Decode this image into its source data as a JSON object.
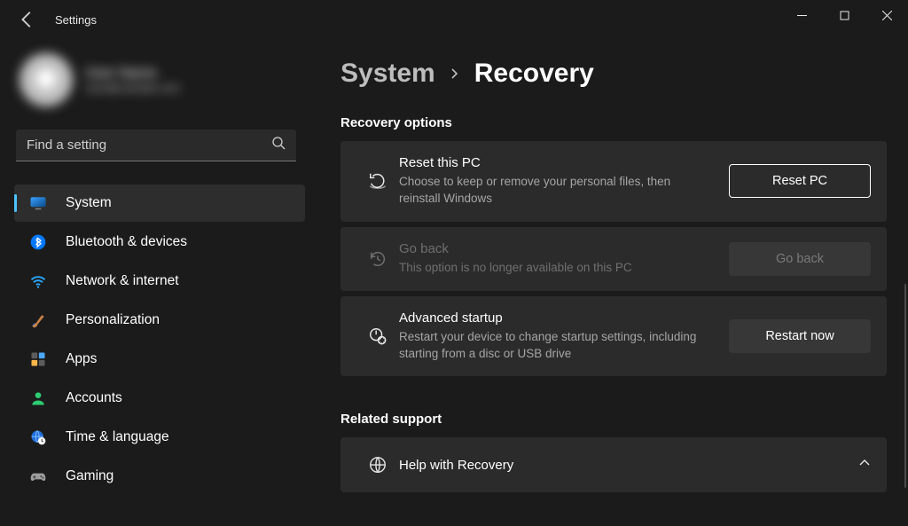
{
  "app": {
    "title": "Settings"
  },
  "profile": {
    "name": "User Name",
    "sub": "user@example.com"
  },
  "search": {
    "placeholder": "Find a setting"
  },
  "sidebar": {
    "items": [
      {
        "label": "System"
      },
      {
        "label": "Bluetooth & devices"
      },
      {
        "label": "Network & internet"
      },
      {
        "label": "Personalization"
      },
      {
        "label": "Apps"
      },
      {
        "label": "Accounts"
      },
      {
        "label": "Time & language"
      },
      {
        "label": "Gaming"
      }
    ]
  },
  "breadcrumb": {
    "root": "System",
    "leaf": "Recovery"
  },
  "sections": {
    "recovery_options_title": "Recovery options",
    "related_support_title": "Related support"
  },
  "cards": {
    "reset": {
      "title": "Reset this PC",
      "desc": "Choose to keep or remove your personal files, then reinstall Windows",
      "button": "Reset PC"
    },
    "goback": {
      "title": "Go back",
      "desc": "This option is no longer available on this PC",
      "button": "Go back"
    },
    "advanced": {
      "title": "Advanced startup",
      "desc": "Restart your device to change startup settings, including starting from a disc or USB drive",
      "button": "Restart now"
    },
    "help": {
      "title": "Help with Recovery"
    }
  }
}
